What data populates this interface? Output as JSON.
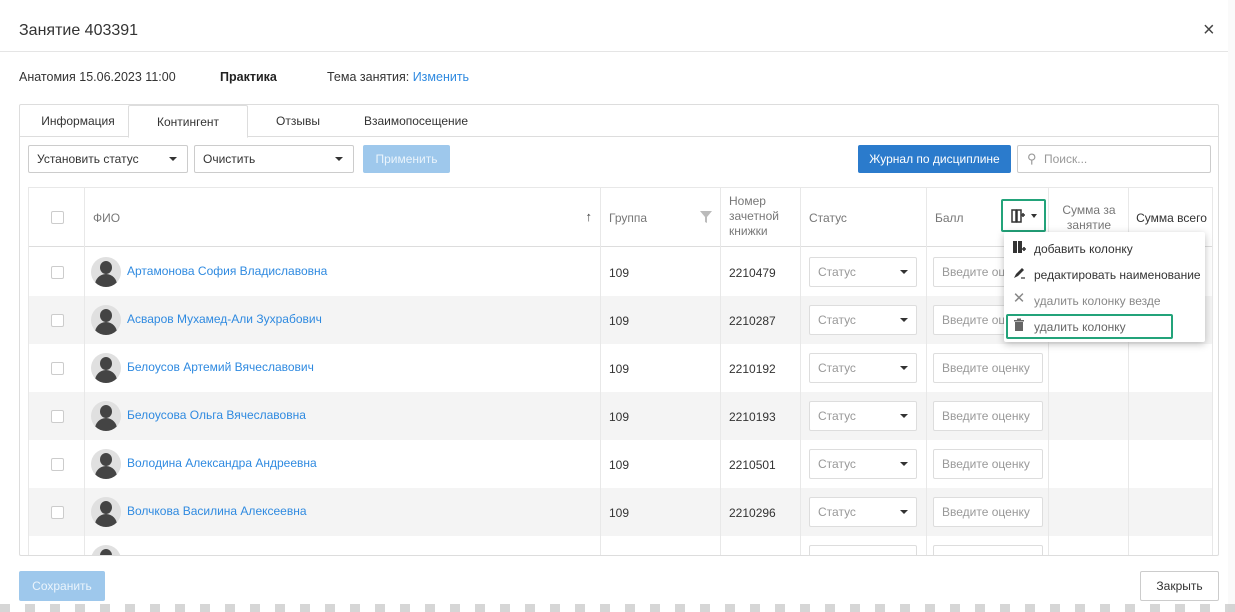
{
  "modal": {
    "title": "Занятие 403391",
    "close_icon": "×"
  },
  "info": {
    "course_datetime": "Анатомия 15.06.2023 11:00",
    "lesson_type": "Практика",
    "topic_label": "Тема занятия: ",
    "topic_link": "Изменить"
  },
  "tabs": [
    {
      "label": "Информация",
      "active": false
    },
    {
      "label": "Контингент",
      "active": true
    },
    {
      "label": "Отзывы",
      "active": false
    },
    {
      "label": "Взаимопосещение",
      "active": false
    }
  ],
  "toolbar": {
    "status_select": "Установить статус",
    "clear_select": "Очистить",
    "apply_button": "Применить",
    "journal_button": "Журнал по дисциплине",
    "search_placeholder": "Поиск..."
  },
  "table": {
    "headers": {
      "name": "ФИО",
      "sort_arrow": "↑",
      "group": "Группа",
      "record_book": "Номер зачетной книжки",
      "status": "Статус",
      "score": "Балл",
      "lesson_sum": "Сумма за занятие",
      "total_sum": "Сумма всего"
    },
    "status_placeholder": "Статус",
    "score_placeholder": "Введите оценку",
    "rows": [
      {
        "name": "Артамонова София Владиславовна",
        "group": "109",
        "record": "2210479"
      },
      {
        "name": "Асваров Мухамед-Али Зухрабович",
        "group": "109",
        "record": "2210287"
      },
      {
        "name": "Белоусов Артемий Вячеславович",
        "group": "109",
        "record": "2210192"
      },
      {
        "name": "Белоусова Ольга Вячеславовна",
        "group": "109",
        "record": "2210193"
      },
      {
        "name": "Володина Александра Андреевна",
        "group": "109",
        "record": "2210501"
      },
      {
        "name": "Волчкова Василина Алексеевна",
        "group": "109",
        "record": "2210296"
      }
    ]
  },
  "column_menu": {
    "items": [
      {
        "label": "добавить колонку",
        "icon": "add-column-icon"
      },
      {
        "label": "редактировать наименование",
        "icon": "edit-icon"
      },
      {
        "label": "удалить колонку везде",
        "icon": "close-icon"
      },
      {
        "label": "удалить колонку",
        "icon": "trash-icon"
      }
    ]
  },
  "footer": {
    "save_button": "Сохранить",
    "close_button": "Закрыть"
  },
  "colors": {
    "accent": "#2b7bcc",
    "link": "#2f8ae0",
    "highlight": "#23a37a",
    "disabled": "#9ec8ec"
  }
}
